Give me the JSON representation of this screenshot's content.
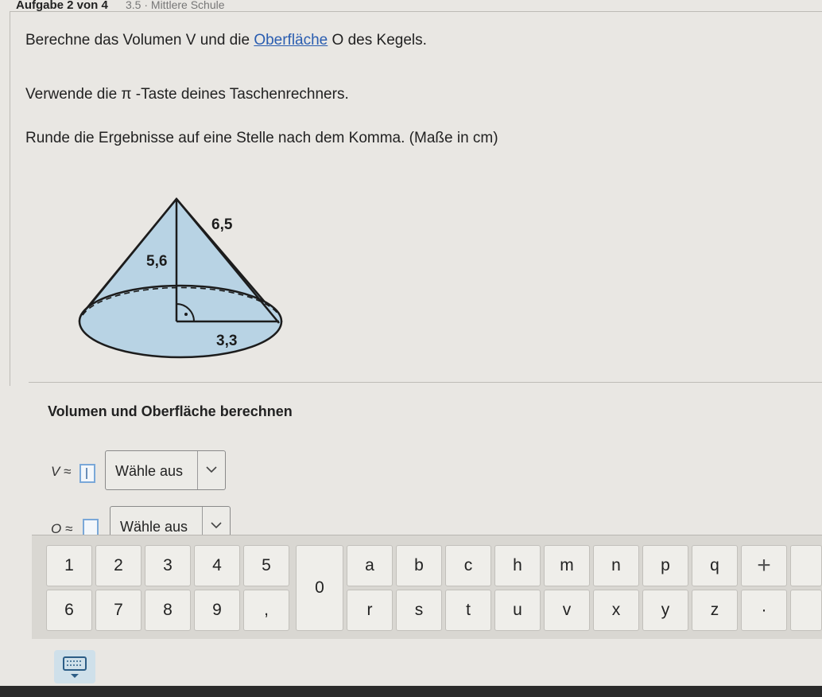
{
  "header": {
    "title": "Aufgabe 2 von 4",
    "crumb": "3.5 · Mittlere Schule"
  },
  "task": {
    "line1_pre": "Berechne das Volumen V und die ",
    "line1_link": "Oberfläche",
    "line1_post": " O des Kegels.",
    "line2": "Verwende die π -Taste deines Taschenrechners.",
    "line3": "Runde die Ergebnisse auf eine Stelle nach dem Komma. (Maße in cm)"
  },
  "figure": {
    "slant_label": "6,5",
    "height_label": "5,6",
    "radius_label": "3,3",
    "fill_color": "#b8d3e4",
    "stroke_color": "#1c1c1c"
  },
  "section": {
    "title": "Volumen und Oberfläche berechnen"
  },
  "answers": {
    "volume_label": "V ≈",
    "volume_unit_select": "Wähle aus",
    "surface_label": "O ≈",
    "surface_unit_select": "Wähle aus"
  },
  "keyboard": {
    "row1_digits": [
      "1",
      "2",
      "3",
      "4",
      "5"
    ],
    "row2_digits": [
      "6",
      "7",
      "8",
      "9",
      ","
    ],
    "zero": "0",
    "row1_letters": [
      "a",
      "b",
      "c",
      "h",
      "m",
      "n",
      "p",
      "q",
      "+"
    ],
    "row2_letters": [
      "r",
      "s",
      "t",
      "u",
      "v",
      "x",
      "y",
      "z",
      "·"
    ]
  },
  "icons": {
    "dropdown": "chevron-down-icon",
    "keyboard_toggle": "keyboard-icon"
  }
}
